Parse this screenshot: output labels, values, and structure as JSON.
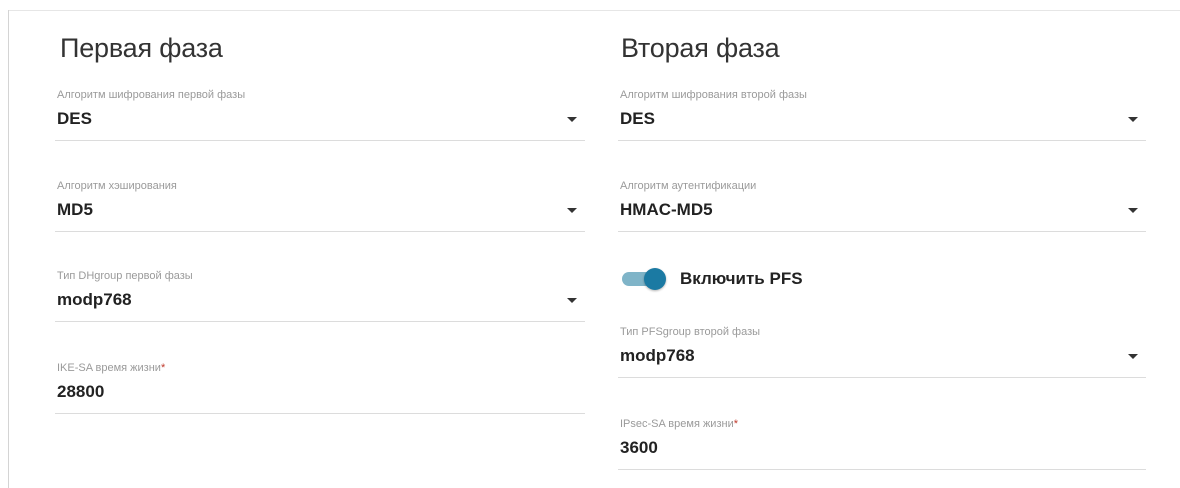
{
  "phase1": {
    "title": "Первая фаза",
    "encryption": {
      "label": "Алгоритм шифрования первой фазы",
      "value": "DES"
    },
    "hashing": {
      "label": "Алгоритм хэширования",
      "value": "MD5"
    },
    "dhgroup": {
      "label": "Тип DHgroup первой фазы",
      "value": "modp768"
    },
    "ike_lifetime": {
      "label": "IKE-SA время жизни",
      "required_mark": "*",
      "value": "28800"
    }
  },
  "phase2": {
    "title": "Вторая фаза",
    "encryption": {
      "label": "Алгоритм шифрования второй фазы",
      "value": "DES"
    },
    "authentication": {
      "label": "Алгоритм аутентификации",
      "value": "HMAC-MD5"
    },
    "pfs_toggle": {
      "label": "Включить PFS",
      "enabled": true
    },
    "pfsgroup": {
      "label": "Тип PFSgroup второй фазы",
      "value": "modp768"
    },
    "ipsec_lifetime": {
      "label": "IPsec-SA время жизни",
      "required_mark": "*",
      "value": "3600"
    }
  },
  "colors": {
    "toggle_knob": "#1b7aa3",
    "toggle_track": "#7fb4c8",
    "required_mark": "#c0392b"
  },
  "icons": {
    "dropdown": "caret-down-icon"
  }
}
